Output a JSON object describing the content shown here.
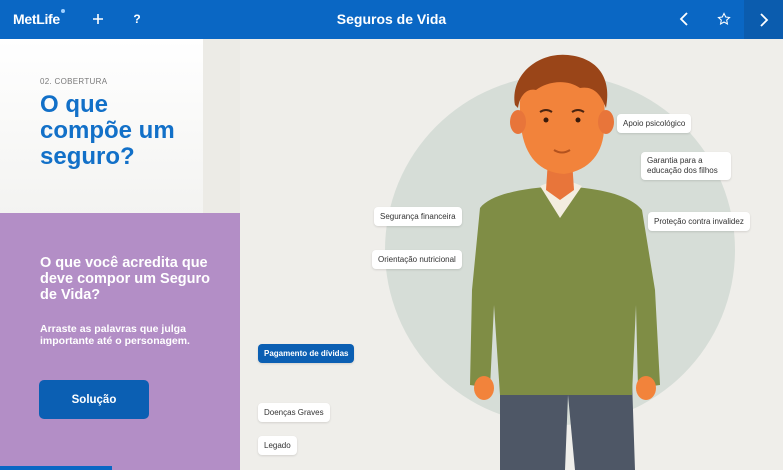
{
  "header": {
    "logo_text": "MetLife",
    "add_label": "+",
    "help_label": "?",
    "title": "Seguros de Vida",
    "prev_label": "‹",
    "favorite_label": "☆",
    "next_label": "›"
  },
  "intro": {
    "section_label": "02. COBERTURA",
    "heading": "O que compõe um seguro?"
  },
  "panel": {
    "question": "O que você acredita que deve compor um Seguro de Vida?",
    "hint": "Arraste as palavras que julga importante até o personagem.",
    "solve_button": "Solução"
  },
  "words": [
    {
      "label": "Apoio psicológico"
    },
    {
      "label": "Garantia para a educação dos filhos"
    },
    {
      "label": "Segurança financeira"
    },
    {
      "label": "Proteção contra invalidez"
    },
    {
      "label": "Orientação nutricional"
    },
    {
      "label": "Pagamento de dívidas"
    },
    {
      "label": "Doenças Graves"
    },
    {
      "label": "Legado"
    }
  ],
  "colors": {
    "brand_blue": "#0a67c4",
    "panel_purple": "#b38ec6",
    "circle": "#d6ddd7",
    "sweater": "#7f8d45",
    "skin": "#f2833b",
    "hair": "#9a4518",
    "pants": "#4e5766"
  },
  "icons": {
    "add": "plus-icon",
    "help": "question-icon",
    "prev": "chevron-left-icon",
    "favorite": "star-icon",
    "next": "chevron-right-icon"
  }
}
